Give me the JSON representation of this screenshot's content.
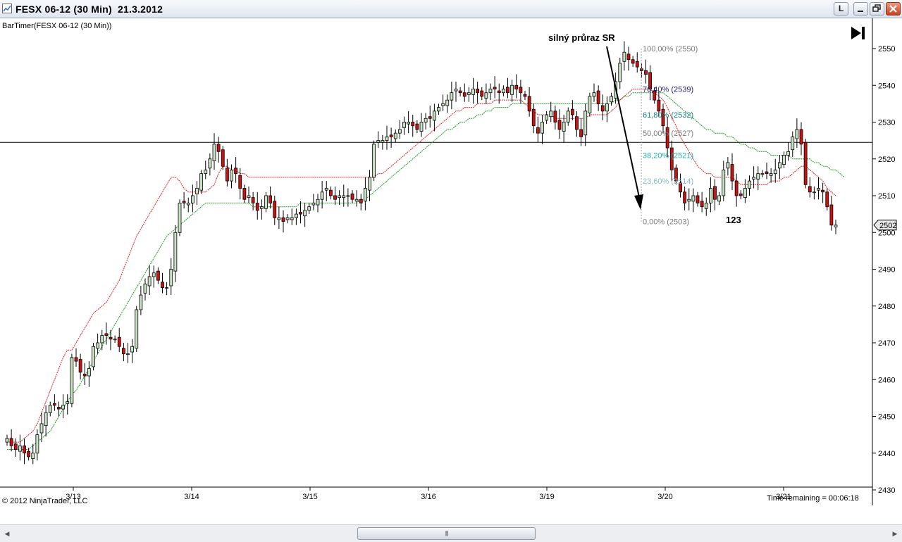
{
  "window": {
    "title": "FESX 06-12 (30 Min)  21.3.2012",
    "buttons": [
      "L"
    ]
  },
  "indicator_label": "BarTimer(FESX 06-12 (30 Min))",
  "copyright": "© 2012 NinjaTrader, LLC",
  "timer_text": "Time remaining = 00:06:18",
  "annotation": "silný průraz SR",
  "pattern_label": "123",
  "price_marker": "2502",
  "colors": {
    "up": "#c9e2c4",
    "down": "#cc1111",
    "ema_fast": "#e02020",
    "ema_slow": "#1a9a1a",
    "fib": "#6e6e6e"
  },
  "chart_data": {
    "type": "candlestick",
    "symbol": "FESX 06-12",
    "interval": "30 Min",
    "y_ticks": [
      2430,
      2440,
      2450,
      2460,
      2470,
      2480,
      2490,
      2500,
      2510,
      2520,
      2530,
      2540,
      2550
    ],
    "ylim": [
      2427,
      2555
    ],
    "x_ticks": [
      "3/13",
      "3/14",
      "3/15",
      "3/16",
      "3/19",
      "3/20",
      "3/21"
    ],
    "horizontal_line": 2524.5,
    "fib_levels": [
      {
        "label": "100,00% (2550)",
        "value": 2550,
        "color": "#7a7a7a"
      },
      {
        "label": "76,40% (2539)",
        "value": 2539,
        "color": "#1a1a70"
      },
      {
        "label": "61,80% (2532)",
        "value": 2532,
        "color": "#0f7a7a"
      },
      {
        "label": "50,00% (2527)",
        "value": 2527,
        "color": "#7a7a7a"
      },
      {
        "label": "38,20% (2521)",
        "value": 2521,
        "color": "#22b0b0"
      },
      {
        "label": "23,60% (2514)",
        "value": 2514,
        "color": "#8ab8c8"
      },
      {
        "label": "0,00% (2503)",
        "value": 2503,
        "color": "#7a7a7a"
      }
    ],
    "close_series": [
      2444,
      2442,
      2441,
      2442,
      2440,
      2439,
      2440,
      2445,
      2448,
      2451,
      2453,
      2453,
      2452,
      2453,
      2454,
      2466,
      2465,
      2462,
      2461,
      2463,
      2469,
      2470,
      2472,
      2472,
      2471,
      2471,
      2469,
      2467,
      2467,
      2469,
      2479,
      2483,
      2486,
      2488,
      2489,
      2487,
      2485,
      2485,
      2490,
      2500,
      2508,
      2508,
      2508,
      2510,
      2512,
      2516,
      2517,
      2520,
      2524,
      2522,
      2518,
      2514,
      2517,
      2516,
      2512,
      2509,
      2510,
      2508,
      2506,
      2507,
      2510,
      2508,
      2504,
      2504,
      2503,
      2504,
      2504,
      2505,
      2505,
      2506,
      2507,
      2508,
      2509,
      2511,
      2512,
      2510,
      2509,
      2510,
      2510,
      2510,
      2509,
      2509,
      2508,
      2512,
      2515,
      2524,
      2525,
      2525,
      2526,
      2526,
      2527,
      2528,
      2530,
      2530,
      2529,
      2528,
      2530,
      2531,
      2531,
      2533,
      2534,
      2535,
      2536,
      2538,
      2539,
      2538,
      2537,
      2538,
      2539,
      2538,
      2537,
      2538,
      2539,
      2539,
      2538,
      2539,
      2538,
      2540,
      2539,
      2538,
      2537,
      2533,
      2529,
      2527,
      2530,
      2532,
      2533,
      2530,
      2528,
      2530,
      2533,
      2532,
      2528,
      2526,
      2533,
      2537,
      2538,
      2535,
      2533,
      2535,
      2537,
      2541,
      2546,
      2549,
      2547,
      2546,
      2545,
      2544,
      2543,
      2539,
      2536,
      2533,
      2529,
      2523,
      2517,
      2514,
      2511,
      2508,
      2509,
      2510,
      2508,
      2507,
      2508,
      2512,
      2509,
      2510,
      2517,
      2519,
      2514,
      2510,
      2510,
      2512,
      2514,
      2515,
      2516,
      2516,
      2516,
      2516,
      2517,
      2519,
      2521,
      2522,
      2526,
      2528,
      2524,
      2513,
      2511,
      2511,
      2512,
      2511,
      2507,
      2502,
      2502
    ],
    "ema_fast": [
      2443,
      2443,
      2443,
      2443,
      2444,
      2445,
      2446,
      2448,
      2451,
      2454,
      2457,
      2460,
      2463,
      2466,
      2468,
      2468,
      2470,
      2472,
      2474,
      2476,
      2478,
      2479,
      2480,
      2481,
      2483,
      2485,
      2487,
      2490,
      2493,
      2496,
      2499,
      2501,
      2503,
      2505,
      2507,
      2509,
      2511,
      2513,
      2515,
      2515,
      2514,
      2512,
      2511,
      2511,
      2511,
      2511,
      2511,
      2512,
      2513,
      2516,
      2518,
      2518,
      2517,
      2517,
      2516,
      2516,
      2515,
      2515,
      2515,
      2515,
      2515,
      2515,
      2515,
      2515,
      2515,
      2515,
      2515,
      2515,
      2515,
      2515,
      2515,
      2515,
      2515,
      2515,
      2515,
      2515,
      2515,
      2515,
      2515,
      2515,
      2515,
      2515,
      2515,
      2515,
      2515,
      2515,
      2516,
      2516,
      2517,
      2518,
      2519,
      2520,
      2521,
      2522,
      2523,
      2524,
      2525,
      2526,
      2527,
      2528,
      2529,
      2530,
      2531,
      2532,
      2533,
      2533,
      2534,
      2534,
      2534,
      2535,
      2535,
      2535,
      2535,
      2536,
      2536,
      2536,
      2536,
      2536,
      2536,
      2536,
      2535,
      2534,
      2533,
      2532,
      2532,
      2532,
      2532,
      2531,
      2531,
      2531,
      2531,
      2531,
      2531,
      2531,
      2531,
      2532,
      2532,
      2532,
      2532,
      2532,
      2533,
      2534,
      2536,
      2537,
      2538,
      2539,
      2539,
      2539,
      2539,
      2539,
      2538,
      2537,
      2536,
      2534,
      2531,
      2529,
      2526,
      2524,
      2522,
      2520,
      2518,
      2517,
      2516,
      2516,
      2515,
      2515,
      2515,
      2515,
      2515,
      2514,
      2513,
      2513,
      2513,
      2513,
      2513,
      2513,
      2513,
      2514,
      2514,
      2514,
      2515,
      2515,
      2516,
      2517,
      2518,
      2518,
      2517,
      2516,
      2515,
      2514,
      2512,
      2511,
      2510
    ],
    "ema_slow": [
      2441,
      2441,
      2441,
      2441,
      2441,
      2441,
      2442,
      2443,
      2444,
      2445,
      2446,
      2448,
      2450,
      2452,
      2454,
      2456,
      2457,
      2459,
      2461,
      2463,
      2465,
      2467,
      2469,
      2471,
      2473,
      2475,
      2477,
      2479,
      2481,
      2483,
      2485,
      2487,
      2489,
      2491,
      2493,
      2495,
      2497,
      2499,
      2500,
      2501,
      2502,
      2503,
      2504,
      2505,
      2506,
      2507,
      2508,
      2508,
      2508,
      2508,
      2508,
      2508,
      2508,
      2508,
      2508,
      2508,
      2508,
      2507,
      2507,
      2507,
      2507,
      2507,
      2507,
      2507,
      2507,
      2507,
      2507,
      2507,
      2508,
      2508,
      2508,
      2508,
      2508,
      2508,
      2508,
      2508,
      2508,
      2508,
      2508,
      2508,
      2508,
      2508,
      2509,
      2509,
      2510,
      2511,
      2512,
      2513,
      2514,
      2515,
      2516,
      2517,
      2518,
      2519,
      2520,
      2521,
      2522,
      2523,
      2524,
      2525,
      2526,
      2527,
      2528,
      2528,
      2529,
      2530,
      2530,
      2531,
      2531,
      2532,
      2532,
      2533,
      2533,
      2534,
      2534,
      2534,
      2534,
      2535,
      2535,
      2535,
      2535,
      2535,
      2535,
      2535,
      2535,
      2535,
      2535,
      2535,
      2535,
      2535,
      2535,
      2535,
      2535,
      2535,
      2535,
      2535,
      2535,
      2535,
      2535,
      2535,
      2535,
      2536,
      2536,
      2537,
      2537,
      2538,
      2538,
      2538,
      2538,
      2538,
      2538,
      2538,
      2538,
      2537,
      2536,
      2535,
      2534,
      2533,
      2532,
      2531,
      2530,
      2529,
      2528,
      2528,
      2527,
      2527,
      2527,
      2526,
      2526,
      2525,
      2524,
      2524,
      2523,
      2523,
      2522,
      2522,
      2522,
      2521,
      2521,
      2521,
      2521,
      2521,
      2520,
      2520,
      2520,
      2520,
      2520,
      2519,
      2519,
      2518,
      2518,
      2517,
      2517,
      2516,
      2515
    ]
  }
}
